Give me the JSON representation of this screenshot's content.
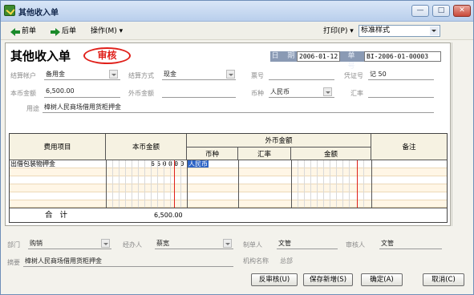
{
  "window": {
    "title": "其他收入单",
    "minimize_label": "—",
    "maximize_label": "□",
    "close_label": "✕"
  },
  "toolbar": {
    "prev_label": "前单",
    "next_label": "后单",
    "ops_label": "操作(M) ▾",
    "print_label": "打印(P) ▾",
    "style_value": "标准样式"
  },
  "header": {
    "title": "其他收入单",
    "stamp": "审核",
    "date_label": "日 期",
    "date_value": "2006-01-12",
    "docno_label": "单 号",
    "docno_value": "BI-2006-01-00003",
    "account_label": "结算帐户",
    "account_value": "备用金",
    "method_label": "结算方式",
    "method_value": "现金",
    "ticket_label": "票号",
    "ticket_value": "",
    "voucher_label": "凭证号",
    "voucher_value": "记 50",
    "base_amount_label": "本币金额",
    "base_amount_value": "6,500.00",
    "foreign_amount_label": "外币金额",
    "foreign_amount_value": "",
    "currency_label": "币种",
    "currency_value": "人民币",
    "rate_label": "汇率",
    "rate_value": "",
    "purpose_label": "用途",
    "purpose_value": "樟树人民商场借用货柜押金"
  },
  "grid": {
    "headers": {
      "item": "费用项目",
      "base_amount": "本币金额",
      "foreign_amount": "外币金额",
      "currency": "币种",
      "rate": "汇率",
      "amount": "金额",
      "remark": "备注"
    },
    "rows": [
      {
        "item": "出借包装物押金",
        "base_amount_digits": "650000",
        "currency": "人民币"
      }
    ],
    "total_label": "合  计",
    "total_value": "6,500.00"
  },
  "footer": {
    "dept_label": "部门",
    "dept_value": "购销",
    "handler_label": "经办人",
    "handler_value": "蔡宽",
    "maker_label": "制单人",
    "maker_value": "文管",
    "auditor_label": "审核人",
    "auditor_value": "文管",
    "summary_label": "摘要",
    "summary_value": "樟树人民商场借用货柜押金",
    "org_label": "机构名称",
    "org_value": "总部"
  },
  "buttons": {
    "unaudit": "反审核(U)",
    "save_new": "保存新增(S)",
    "ok": "确定(A)",
    "cancel": "取消(C)"
  },
  "colors": {
    "stamp": "#e0201a",
    "accent": "#2d64c6",
    "date_label_bg": "#8a9ab4"
  }
}
